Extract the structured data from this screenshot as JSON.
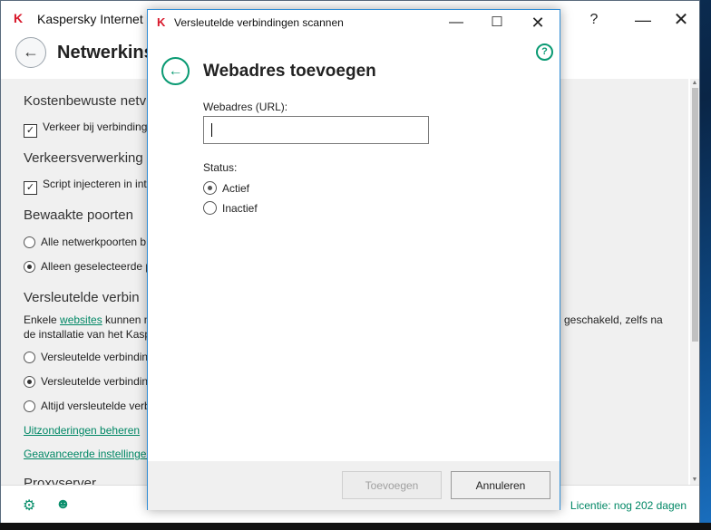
{
  "main_window": {
    "title": "Kaspersky Internet",
    "help_glyph": "?",
    "heading": "Netwerkinst",
    "sections": [
      {
        "title": "Kostenbewuste netv"
      },
      {
        "title": "Verkeersverwerking"
      },
      {
        "title": "Bewaakte poorten"
      },
      {
        "title": "Versleutelde verbin"
      },
      {
        "title": "Proxyserver"
      }
    ],
    "options": {
      "traffic_checkbox": "Verkeer bij verbinding",
      "script_checkbox": "Script injecteren in int",
      "all_ports_radio": "Alle netwerkpoorten b",
      "selected_ports_radio": "Alleen geselecteerde p",
      "enc_radio_1": "Versleutelde verbindin",
      "enc_radio_2": "Versleutelde verbindin",
      "enc_radio_3": "Altijd versleutelde verb"
    },
    "enc_description": {
      "part1": "Enkele ",
      "link": "websites",
      "part2": " kunnen m",
      "right_fragment": "geschakeld, zelfs na",
      "line2": "de installatie van het Kaspe"
    },
    "links": {
      "exceptions": "Uitzonderingen beheren",
      "advanced": "Geavanceerde instellingen"
    },
    "footer": {
      "license": "Licentie: nog 202 dagen"
    }
  },
  "dialog": {
    "title": "Versleutelde verbindingen scannen",
    "heading": "Webadres toevoegen",
    "url_label": "Webadres (URL):",
    "url_value": "",
    "status_label": "Status:",
    "status_options": [
      "Actief",
      "Inactief"
    ],
    "selected_status": "Actief",
    "add_button": "Toevoegen",
    "cancel_button": "Annuleren",
    "help_glyph": "?"
  },
  "colors": {
    "accent_green": "#0a9a73",
    "kaspersky_red": "#d8182b",
    "link_green": "#008765"
  }
}
